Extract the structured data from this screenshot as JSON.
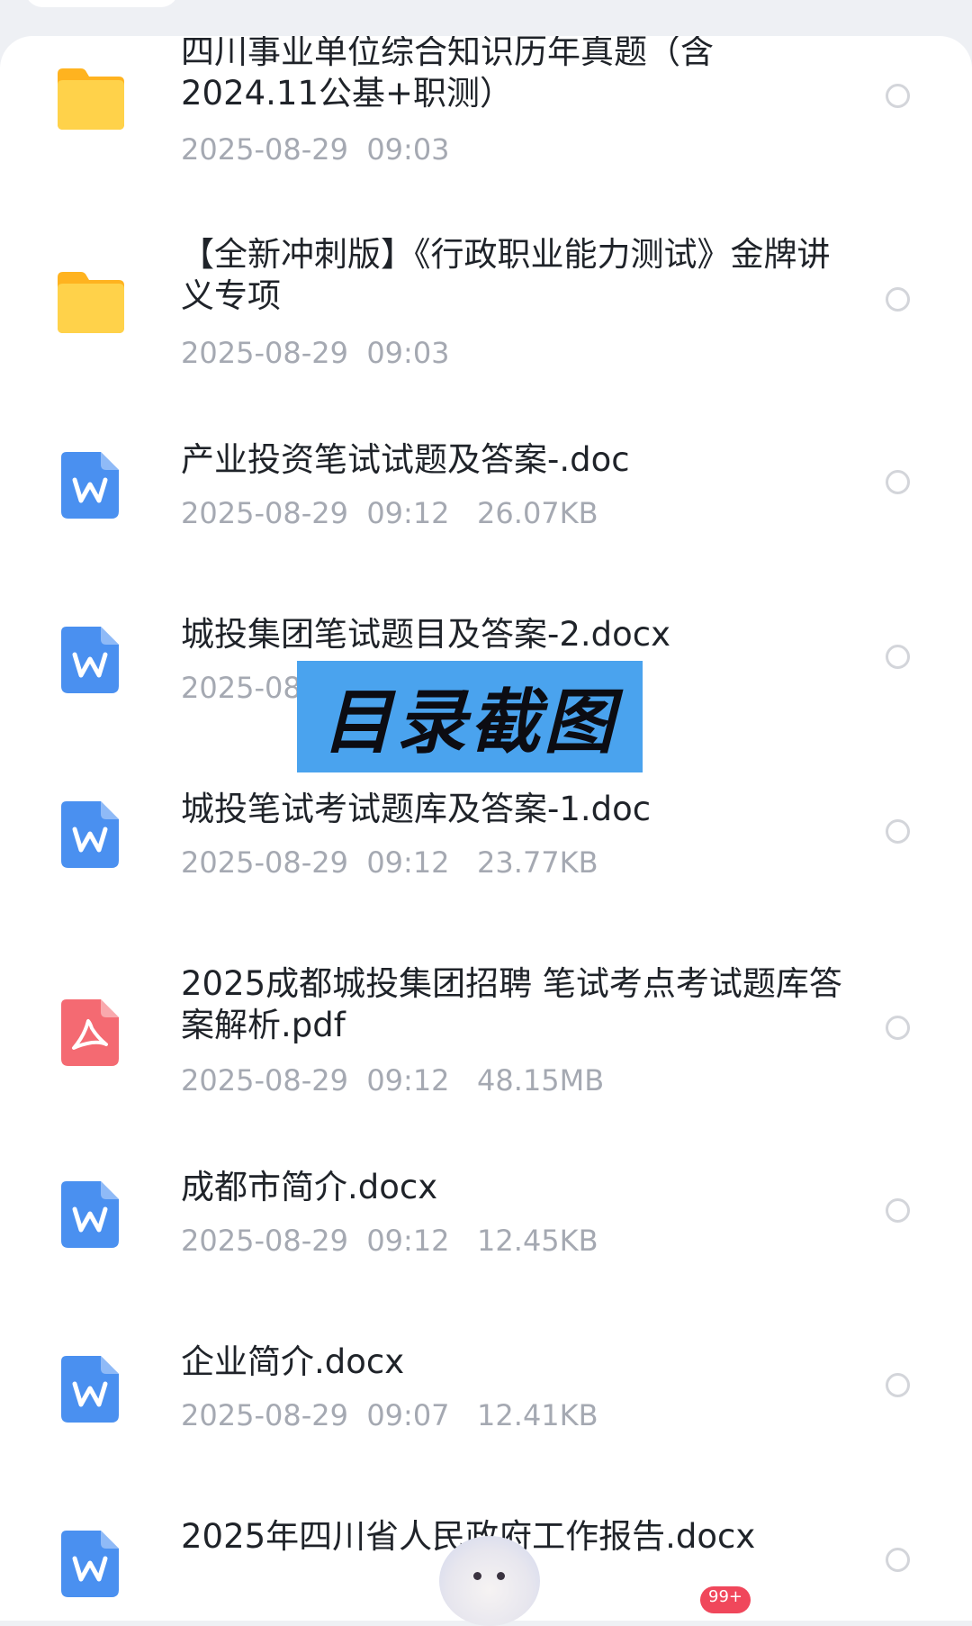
{
  "watermark": "目录截图",
  "notification_badge": "99+",
  "files": [
    {
      "type": "folder",
      "name": "四川事业单位综合知识历年真题（含2024.11公基+职测）",
      "meta": "2025-08-29  09:03"
    },
    {
      "type": "folder",
      "name": "【全新冲刺版】《行政职业能力测试》金牌讲义专项",
      "meta": "2025-08-29  09:03"
    },
    {
      "type": "word",
      "name": "产业投资笔试试题及答案-.doc",
      "meta": "2025-08-29  09:12   26.07KB"
    },
    {
      "type": "word",
      "name": "城投集团笔试题目及答案-2.docx",
      "meta": "2025-08"
    },
    {
      "type": "word",
      "name": "城投笔试考试题库及答案-1.doc",
      "meta": "2025-08-29  09:12   23.77KB"
    },
    {
      "type": "pdf",
      "name": "2025成都城投集团招聘 笔试考点考试题库答案解析.pdf",
      "meta": "2025-08-29  09:12   48.15MB"
    },
    {
      "type": "word",
      "name": "成都市简介.docx",
      "meta": "2025-08-29  09:12   12.45KB"
    },
    {
      "type": "word",
      "name": "企业简介.docx",
      "meta": "2025-08-29  09:07   12.41KB"
    },
    {
      "type": "word",
      "name": "2025年四川省人民政府工作报告.docx",
      "meta": ""
    }
  ],
  "colors": {
    "folder": "#ffc93c",
    "word": "#4a90f0",
    "pdf": "#f46a72",
    "watermark_bg": "#4aa3ee"
  }
}
